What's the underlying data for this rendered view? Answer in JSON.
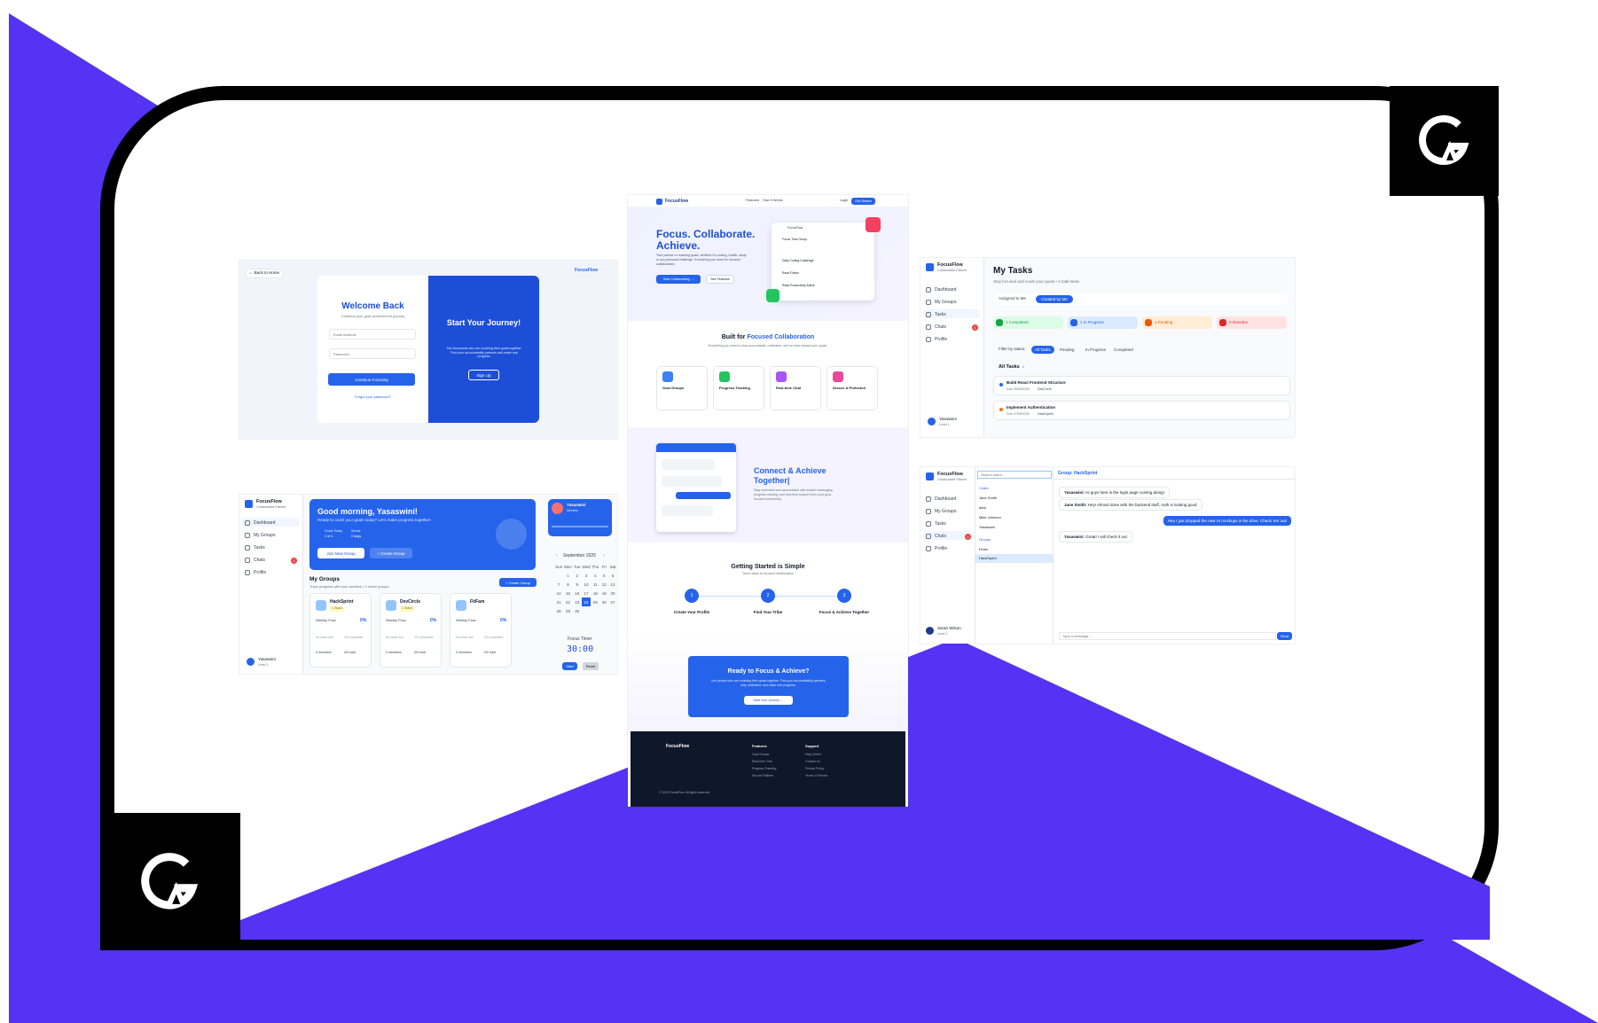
{
  "colors": {
    "purple": "#5433f4",
    "blue": "#2563eb",
    "dark": "#0f172a"
  },
  "login": {
    "back": "← Back to Home",
    "brand": "FocusFlow",
    "title": "Welcome Back",
    "subtitle": "Continue your goal achievement journey",
    "email_placeholder": "Email Address",
    "password_placeholder": "Password",
    "submit": "Continue Focusing",
    "forgot": "Forgot your password?",
    "side_title": "Start Your Journey!",
    "side_text": "Join thousands who are crushing their goals together. Find your accountability partners and make real progress.",
    "signup": "Sign Up"
  },
  "landing": {
    "brand": "FocusFlow",
    "nav": [
      "Features",
      "How It Works"
    ],
    "login": "Login",
    "cta": "Get Started",
    "hero_title_1": "Focus. Collaborate.",
    "hero_title_2": "Achieve.",
    "hero_text": "Your partner in reaching goals, whether it's coding, health, study or any personal challenge. Everything you need for focused collaboration.",
    "hero_btn": "Start Collaborating →",
    "hero_btn2": "See Features",
    "mock_title": "FocusFlow",
    "mock_items": [
      "Focus Time Group",
      "Daily Coding Challenge",
      "Read Fiction",
      "Read Productivity Article"
    ],
    "built_title": "Built for",
    "built_title_accent": "Focused Collaboration",
    "built_sub": "Everything you need to stay accountable, motivated, and on track toward your goals.",
    "features": [
      {
        "t": "Goal Groups",
        "c": "#3b82f6"
      },
      {
        "t": "Progress Tracking",
        "c": "#22c55e"
      },
      {
        "t": "Real-time Chat",
        "c": "#a855f7"
      },
      {
        "t": "Secure & Protected",
        "c": "#ec4899"
      }
    ],
    "connect_title_1": "Connect & Achieve",
    "connect_title_2": "Together|",
    "connect_text": "Stay motivated and accountable with instant messaging, progress sharing, and real-time support from your goal-focused community.",
    "steps_title": "Getting Started is Simple",
    "steps_sub": "Three steps to focused collaboration",
    "steps": [
      {
        "n": "1",
        "t": "Create Your Profile"
      },
      {
        "n": "2",
        "t": "Find Your Tribe"
      },
      {
        "n": "3",
        "t": "Focus & Achieve Together"
      }
    ],
    "ready_title": "Ready to Focus & Achieve?",
    "ready_text": "Join people who are crushing their goals together. Find your accountability partners, stay motivated, and make real progress.",
    "ready_btn": "Start Your Journey →",
    "footer_brand": "FocusFlow",
    "footer_cols": [
      {
        "h": "Features",
        "items": [
          "Goal Groups",
          "Real-time Chat",
          "Progress Tracking",
          "Secure Platform"
        ]
      },
      {
        "h": "Support",
        "items": [
          "Help Center",
          "Contact Us",
          "Privacy Policy",
          "Terms of Service"
        ]
      }
    ],
    "footer_copy": "© 2025 FocusFlow. All rights reserved."
  },
  "tasks": {
    "brand": "FocusFlow",
    "brand_sub": "Collaborative Planner",
    "nav": [
      "Dashboard",
      "My Groups",
      "Tasks",
      "Chats",
      "Profile"
    ],
    "title": "My Tasks",
    "subtitle": "Stay focused and crush your goals • 2 total tasks",
    "tab1": "Assigned to Me",
    "tab2": "Created by Me",
    "stats": [
      {
        "t": "1 Completed",
        "bg": "#dcfce7",
        "c": "#16a34a"
      },
      {
        "t": "1 In Progress",
        "bg": "#dbeafe",
        "c": "#2563eb"
      },
      {
        "t": "1 Pending",
        "bg": "#ffedd5",
        "c": "#ea580c"
      },
      {
        "t": "0 Overdue",
        "bg": "#fee2e2",
        "c": "#dc2626"
      }
    ],
    "filter_label": "Filter by status:",
    "filters": [
      "All Tasks",
      "Pending",
      "In Progress",
      "Completed"
    ],
    "all_tasks": "All Tasks",
    "count": "2",
    "items": [
      {
        "t": "Build React Frontend Structure",
        "d": "Due 25/09/2025",
        "g": "DevCircle",
        "c": "#2563eb"
      },
      {
        "t": "Implement Authentication",
        "d": "Due 27/09/2025",
        "g": "HackSprint",
        "c": "#f97316"
      }
    ],
    "user": "Yasaswini",
    "level": "Level 1"
  },
  "dash": {
    "brand": "FocusFlow",
    "brand_sub": "Collaborative Planner",
    "nav": [
      "Dashboard",
      "My Groups",
      "Tasks",
      "Chats",
      "Profile"
    ],
    "greet": "Good morning, Yasaswini!",
    "greet_sub": "Ready to crush your goals today? Let's make progress together!",
    "goals": "Goals Today",
    "goals_v": "1 of 4",
    "streak": "Streak",
    "streak_v": "0 days",
    "join_btn": "Join New Group",
    "create_btn": "+ Create Group",
    "profile_name": "Yasaswini",
    "profile_role": "Member",
    "groups_title": "My Groups",
    "groups_sub": "Track progress with your buddies • 3 active groups",
    "groups_btn": "+ Create Group",
    "groups": [
      {
        "n": "HackSprint",
        "tag": "1 Stack",
        "p": "0%"
      },
      {
        "n": "DevCircle",
        "tag": "1 Stack",
        "p": "0%"
      },
      {
        "n": "FitFam",
        "tag": "",
        "p": "0%"
      }
    ],
    "weekly": "Weekly Flow",
    "no_tasks": "No tasks due",
    "completed": "0/0 completed",
    "members": "0 members",
    "total": "0/0 total",
    "month": "September 2025",
    "days": [
      "Sun",
      "Mon",
      "Tue",
      "Wed",
      "Thu",
      "Fri",
      "Sat"
    ],
    "timer_label": "Focus Timer",
    "timer": "30:00",
    "start": "Start",
    "reset": "Reset",
    "user": "Yasaswini",
    "level": "Level 1"
  },
  "chat": {
    "brand": "FocusFlow",
    "brand_sub": "Collaborative Planner",
    "nav": [
      "Dashboard",
      "My Groups",
      "Tasks",
      "Chats",
      "Profile"
    ],
    "search": "Search users...",
    "chats_label": "Chats",
    "users": [
      "Jane Smith",
      "alice",
      "Mike Johnson",
      "Yasaswini"
    ],
    "groups_label": "Groups",
    "groups": [
      "Fluter",
      "HackSprint"
    ],
    "header": "Group: HackSprint",
    "msgs": [
      {
        "who": "Yasaswini:",
        "t": "Hi guys here is the login page coming along!",
        "me": false
      },
      {
        "who": "Jane Smith:",
        "t": "Hey! Almost done with the backend stuff, Auth is looking good",
        "me": false
      },
      {
        "who": "",
        "t": "Hey I just dropped the new UI mockups in the drive. Check 'em out!",
        "me": true
      },
      {
        "who": "Yasaswini:",
        "t": "Great! I will check it out",
        "me": false
      }
    ],
    "input_placeholder": "Type a message...",
    "send": "Send",
    "user": "Sarah Wilson",
    "level": "Level 1"
  }
}
